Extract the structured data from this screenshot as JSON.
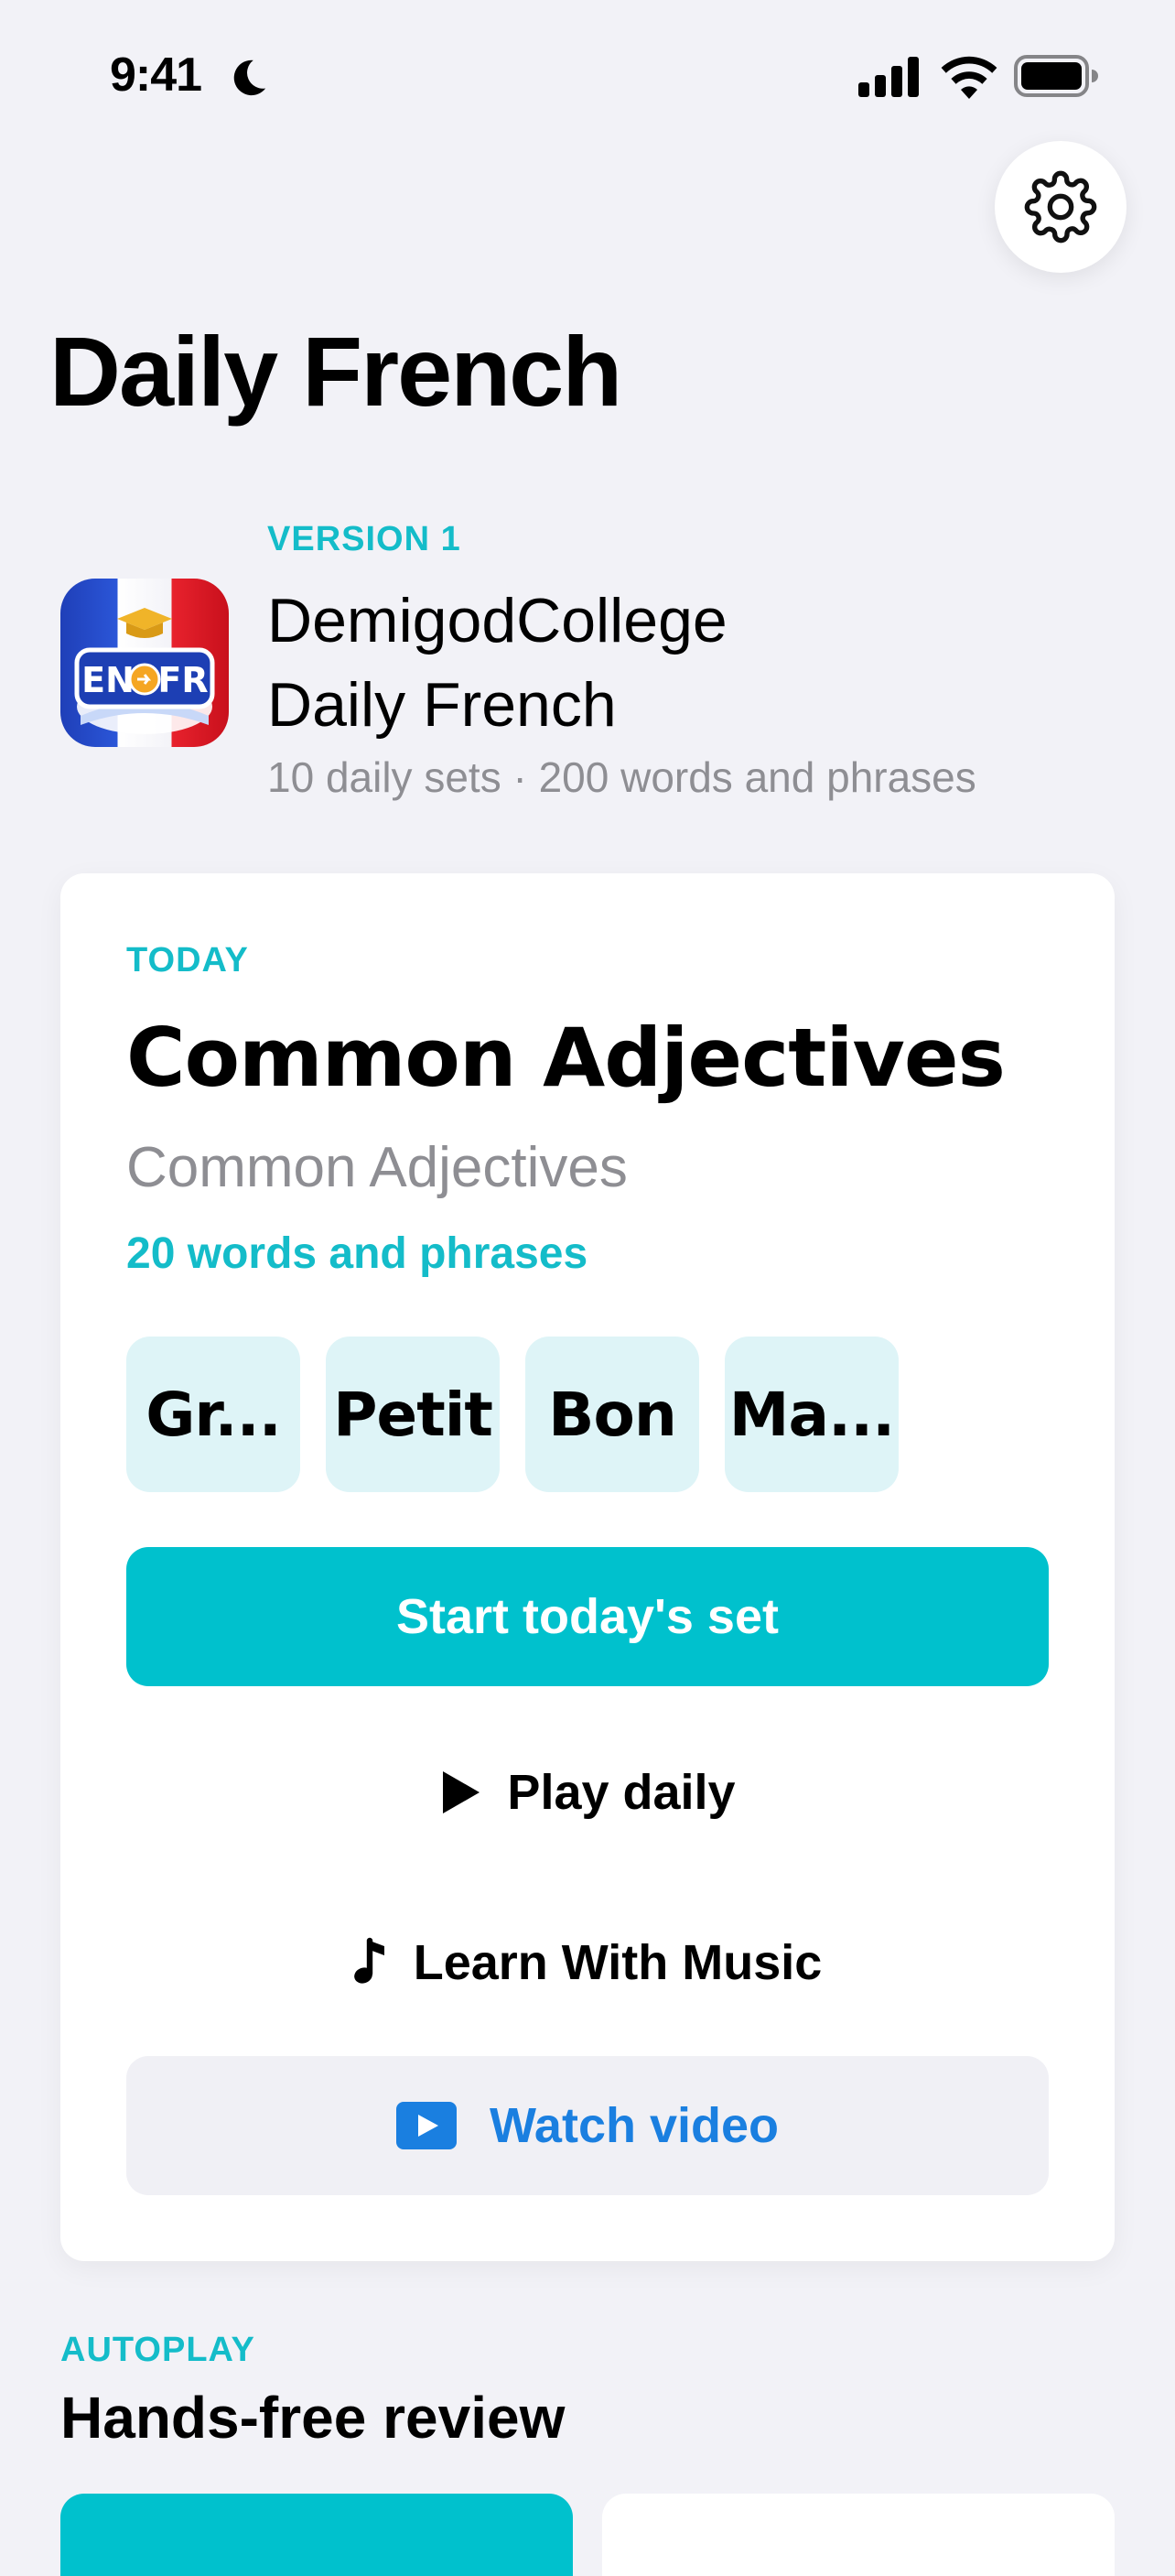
{
  "status_bar": {
    "time": "9:41"
  },
  "page": {
    "title": "Daily French"
  },
  "course": {
    "version_label": "VERSION 1",
    "name_line1": "DemigodCollege",
    "name_line2": "Daily French",
    "meta": "10 daily sets · 200 words and phrases",
    "icon_text_left": "EN",
    "icon_text_right": "FR"
  },
  "today": {
    "label": "TODAY",
    "title": "Common Adjectives",
    "subtitle": "Common Adjectives",
    "count": "20 words and phrases",
    "chips": [
      "Gr...",
      "Petit",
      "Bon",
      "Ma..."
    ],
    "start_label": "Start today's set",
    "play_label": "Play daily",
    "music_label": "Learn With Music",
    "video_label": "Watch video"
  },
  "autoplay": {
    "label": "AUTOPLAY",
    "title": "Hands-free review"
  },
  "colors": {
    "accent": "#00c1cd",
    "accent_text": "#14bcc9",
    "link_blue": "#1a7fe0",
    "background": "#f2f2f7"
  }
}
